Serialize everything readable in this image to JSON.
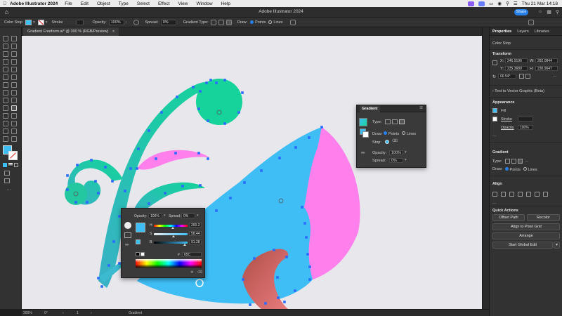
{
  "menubar": {
    "app_name": "Adobe Illustrator 2024",
    "items": [
      "File",
      "Edit",
      "Object",
      "Type",
      "Select",
      "Effect",
      "View",
      "Window",
      "Help"
    ],
    "clock": "Thu 21 Mar 14:18"
  },
  "titlebar": {
    "title": "Adobe Illustrator 2024",
    "share_label": "Share"
  },
  "controlbar": {
    "context_label": "Color Stop",
    "stroke_label": "Stroke",
    "opacity_label": "Opacity:",
    "opacity_value": "100%",
    "spread_label": "Spread:",
    "spread_value": "0%",
    "gradient_type_label": "Gradient Type:",
    "draw_label": "Draw:",
    "draw_points": "Points",
    "draw_lines": "Lines"
  },
  "document": {
    "tab_label": "Gradient Freeform.ai* @ 300 % (RGB/Preview)"
  },
  "status": {
    "zoom": "300%",
    "rotation": "0°",
    "artboard": "1",
    "tool": "Gradient"
  },
  "properties_panel": {
    "tabs": [
      "Properties",
      "Layers",
      "Libraries"
    ],
    "selection_type": "Color Stop",
    "transform": {
      "header": "Transform",
      "x_label": "X:",
      "x_value": "246.9196",
      "y_label": "Y:",
      "y_value": "235.3680",
      "w_label": "W:",
      "w_value": "282.0844",
      "h_label": "H:",
      "h_value": "230.9647",
      "angle_value": "66.54°"
    },
    "text_to_vector": "Text to Vector Graphic (Beta)",
    "appearance": {
      "header": "Appearance",
      "fill_label": "Fill",
      "stroke_label": "Stroke",
      "opacity_label": "Opacity",
      "opacity_value": "100%"
    },
    "gradient": {
      "header": "Gradient",
      "type_label": "Type:",
      "draw_label": "Draw:",
      "points_label": "Points",
      "lines_label": "Lines"
    },
    "align": {
      "header": "Align"
    },
    "quick_actions": {
      "header": "Quick Actions",
      "offset_path": "Offset Path",
      "recolor": "Recolor",
      "align_pixel_grid": "Align to Pixel Grid",
      "arrange": "Arrange",
      "start_global_edit": "Start Global Edit"
    }
  },
  "gradient_panel": {
    "title": "Gradient",
    "type_label": "Type:",
    "draw_label": "Draw:",
    "points_label": "Points",
    "lines_label": "Lines",
    "stop_label": "Stop:",
    "opacity_label": "Opacity:",
    "opacity_value": "100%",
    "spread_label": "Spread:",
    "spread_value": "0%"
  },
  "color_panel": {
    "opacity_label": "Opacity:",
    "opacity_value": "100%",
    "spread_label": "Spread:",
    "spread_value": "0%",
    "h_label": "H",
    "h_value": "200.2",
    "s_label": "S",
    "s_value": "58.44",
    "b_label": "B",
    "b_value": "91.28",
    "hex_prefix": "#",
    "hex_value": "65C",
    "h_level": 0.556,
    "s_level": 0.584,
    "b_level": 0.913
  },
  "colors": {
    "accent": "#2680eb",
    "selected_color": "#3fbef5",
    "teal": "#1ec8a8",
    "pink": "#ff7fec",
    "canvas": "#e8e7ec"
  }
}
